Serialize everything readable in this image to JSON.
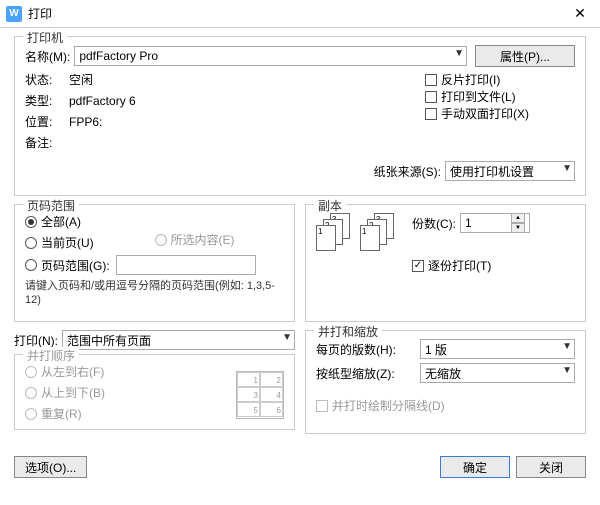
{
  "title": "打印",
  "printer_group": "打印机",
  "name_label": "名称(M):",
  "name_value": "pdfFactory Pro",
  "properties_button": "属性(P)...",
  "status_label": "状态:",
  "status_value": "空闲",
  "type_label": "类型:",
  "type_value": "pdfFactory 6",
  "location_label": "位置:",
  "location_value": "FPP6:",
  "comment_label": "备注:",
  "reverse_print": "反片打印(I)",
  "print_to_file": "打印到文件(L)",
  "manual_duplex": "手动双面打印(X)",
  "paper_source_label": "纸张来源(S):",
  "paper_source_value": "使用打印机设置",
  "page_range_group": "页码范围",
  "all_pages": "全部(A)",
  "current_page": "当前页(U)",
  "selection": "所选内容(E)",
  "page_range": "页码范围(G):",
  "range_hint": "请键入页码和/或用逗号分隔的页码范围(例如: 1,3,5-12)",
  "print_label": "打印(N):",
  "print_value": "范围中所有页面",
  "order_group": "并打顺序",
  "left_to_right": "从左到右(F)",
  "top_to_bottom": "从上到下(B)",
  "repeat": "重复(R)",
  "copies_group": "副本",
  "copies_label": "份数(C):",
  "copies_value": "1",
  "collate": "逐份打印(T)",
  "zoom_group": "并打和缩放",
  "pages_per_sheet_label": "每页的版数(H):",
  "pages_per_sheet_value": "1 版",
  "scale_label": "按纸型缩放(Z):",
  "scale_value": "无缩放",
  "draw_separator": "并打时绘制分隔线(D)",
  "options_button": "选项(O)...",
  "ok_button": "确定",
  "close_button": "关闭"
}
